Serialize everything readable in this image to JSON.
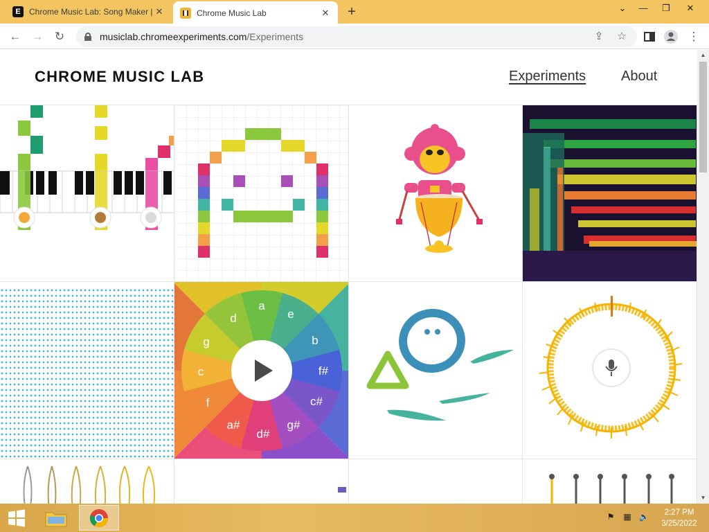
{
  "browser": {
    "tabs": [
      {
        "title": "Chrome Music Lab: Song Maker |",
        "favicon": "E"
      },
      {
        "title": "Chrome Music Lab",
        "favicon": "chrome-music-lab"
      }
    ],
    "url_host": "musiclab.chromeexperiments.com",
    "url_path": "/Experiments"
  },
  "site": {
    "logo": "CHROME MUSIC LAB",
    "nav": {
      "experiments": "Experiments",
      "about": "About"
    }
  },
  "experiments": {
    "chords_wheel_notes": [
      "a",
      "e",
      "b",
      "f#",
      "c#",
      "g#",
      "d#",
      "a#",
      "f",
      "c",
      "g",
      "d"
    ]
  },
  "taskbar": {
    "time": "2:27 PM",
    "date": "3/25/2022"
  },
  "colors": {
    "tabstrip": "#f2c561",
    "taskbar": "#e0b050"
  }
}
